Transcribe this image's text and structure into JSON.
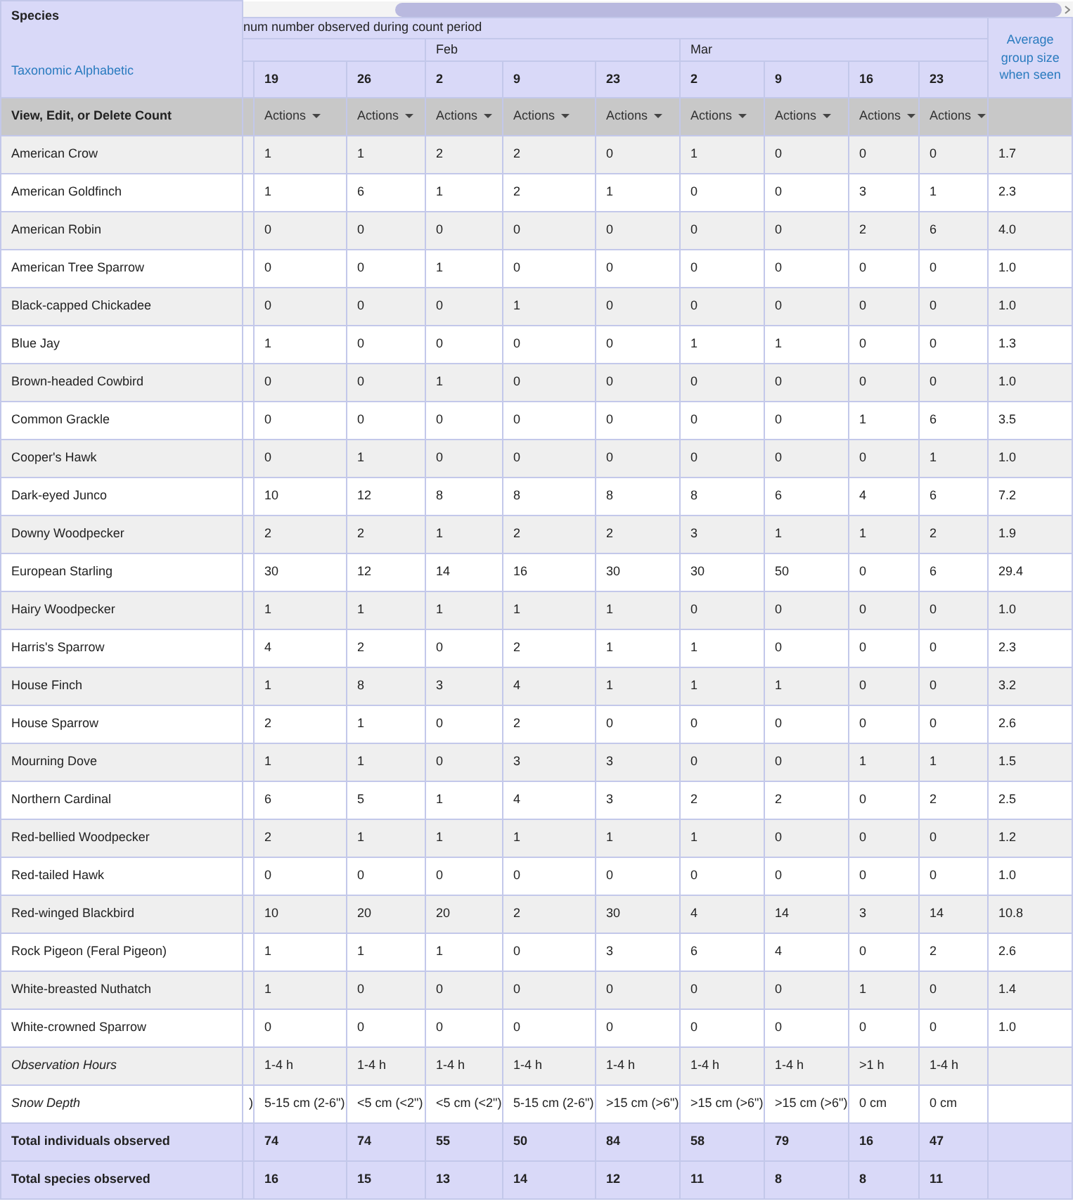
{
  "table": {
    "corner": {
      "title": "Species",
      "sort_link": "Taxonomic Alphabetic"
    },
    "group_header": "num number observed during count period",
    "date_groups": [
      {
        "dates": [
          "19",
          "26"
        ]
      },
      {
        "label": "Feb",
        "dates": [
          "2",
          "9",
          "23"
        ]
      },
      {
        "label": "Mar",
        "dates": [
          "2",
          "9",
          "16",
          "23"
        ]
      }
    ],
    "average_header": "Average group size when seen",
    "actions_row": {
      "label": "View, Edit, or Delete Count",
      "buttons": [
        "Actions",
        "Actions",
        "Actions",
        "Actions",
        "Actions",
        "Actions",
        "Actions",
        "Actions",
        "Actions"
      ]
    },
    "rows": [
      {
        "kind": "species",
        "name": "American Crow",
        "values": [
          "1",
          "1",
          "2",
          "2",
          "0",
          "1",
          "0",
          "0",
          "0"
        ],
        "average": "1.7"
      },
      {
        "kind": "species",
        "name": "American Goldfinch",
        "values": [
          "1",
          "6",
          "1",
          "2",
          "1",
          "0",
          "0",
          "3",
          "1"
        ],
        "average": "2.3"
      },
      {
        "kind": "species",
        "name": "American Robin",
        "values": [
          "0",
          "0",
          "0",
          "0",
          "0",
          "0",
          "0",
          "2",
          "6"
        ],
        "average": "4.0"
      },
      {
        "kind": "species",
        "name": "American Tree Sparrow",
        "values": [
          "0",
          "0",
          "1",
          "0",
          "0",
          "0",
          "0",
          "0",
          "0"
        ],
        "average": "1.0"
      },
      {
        "kind": "species",
        "name": "Black-capped Chickadee",
        "values": [
          "0",
          "0",
          "0",
          "1",
          "0",
          "0",
          "0",
          "0",
          "0"
        ],
        "average": "1.0"
      },
      {
        "kind": "species",
        "name": "Blue Jay",
        "values": [
          "1",
          "0",
          "0",
          "0",
          "0",
          "1",
          "1",
          "0",
          "0"
        ],
        "average": "1.3"
      },
      {
        "kind": "species",
        "name": "Brown-headed Cowbird",
        "values": [
          "0",
          "0",
          "1",
          "0",
          "0",
          "0",
          "0",
          "0",
          "0"
        ],
        "average": "1.0"
      },
      {
        "kind": "species",
        "name": "Common Grackle",
        "values": [
          "0",
          "0",
          "0",
          "0",
          "0",
          "0",
          "0",
          "1",
          "6"
        ],
        "average": "3.5"
      },
      {
        "kind": "species",
        "name": "Cooper's Hawk",
        "values": [
          "0",
          "1",
          "0",
          "0",
          "0",
          "0",
          "0",
          "0",
          "1"
        ],
        "average": "1.0"
      },
      {
        "kind": "species",
        "name": "Dark-eyed Junco",
        "values": [
          "10",
          "12",
          "8",
          "8",
          "8",
          "8",
          "6",
          "4",
          "6"
        ],
        "average": "7.2"
      },
      {
        "kind": "species",
        "name": "Downy Woodpecker",
        "values": [
          "2",
          "2",
          "1",
          "2",
          "2",
          "3",
          "1",
          "1",
          "2"
        ],
        "average": "1.9"
      },
      {
        "kind": "species",
        "name": "European Starling",
        "values": [
          "30",
          "12",
          "14",
          "16",
          "30",
          "30",
          "50",
          "0",
          "6"
        ],
        "average": "29.4"
      },
      {
        "kind": "species",
        "name": "Hairy Woodpecker",
        "values": [
          "1",
          "1",
          "1",
          "1",
          "1",
          "0",
          "0",
          "0",
          "0"
        ],
        "average": "1.0"
      },
      {
        "kind": "species",
        "name": "Harris's Sparrow",
        "values": [
          "4",
          "2",
          "0",
          "2",
          "1",
          "1",
          "0",
          "0",
          "0"
        ],
        "average": "2.3"
      },
      {
        "kind": "species",
        "name": "House Finch",
        "values": [
          "1",
          "8",
          "3",
          "4",
          "1",
          "1",
          "1",
          "0",
          "0"
        ],
        "average": "3.2"
      },
      {
        "kind": "species",
        "name": "House Sparrow",
        "values": [
          "2",
          "1",
          "0",
          "2",
          "0",
          "0",
          "0",
          "0",
          "0"
        ],
        "average": "2.6"
      },
      {
        "kind": "species",
        "name": "Mourning Dove",
        "values": [
          "1",
          "1",
          "0",
          "3",
          "3",
          "0",
          "0",
          "1",
          "1"
        ],
        "average": "1.5"
      },
      {
        "kind": "species",
        "name": "Northern Cardinal",
        "values": [
          "6",
          "5",
          "1",
          "4",
          "3",
          "2",
          "2",
          "0",
          "2"
        ],
        "average": "2.5"
      },
      {
        "kind": "species",
        "name": "Red-bellied Woodpecker",
        "values": [
          "2",
          "1",
          "1",
          "1",
          "1",
          "1",
          "0",
          "0",
          "0"
        ],
        "average": "1.2"
      },
      {
        "kind": "species",
        "name": "Red-tailed Hawk",
        "values": [
          "0",
          "0",
          "0",
          "0",
          "0",
          "0",
          "0",
          "0",
          "0"
        ],
        "average": "1.0"
      },
      {
        "kind": "species",
        "name": "Red-winged Blackbird",
        "values": [
          "10",
          "20",
          "20",
          "2",
          "30",
          "4",
          "14",
          "3",
          "14"
        ],
        "average": "10.8"
      },
      {
        "kind": "species",
        "name": "Rock Pigeon (Feral Pigeon)",
        "values": [
          "1",
          "1",
          "1",
          "0",
          "3",
          "6",
          "4",
          "0",
          "2"
        ],
        "average": "2.6"
      },
      {
        "kind": "species",
        "name": "White-breasted Nuthatch",
        "values": [
          "1",
          "0",
          "0",
          "0",
          "0",
          "0",
          "0",
          "1",
          "0"
        ],
        "average": "1.4"
      },
      {
        "kind": "species",
        "name": "White-crowned Sparrow",
        "values": [
          "0",
          "0",
          "0",
          "0",
          "0",
          "0",
          "0",
          "0",
          "0"
        ],
        "average": "1.0"
      },
      {
        "kind": "condition",
        "name": "Observation Hours",
        "values": [
          "1-4 h",
          "1-4 h",
          "1-4 h",
          "1-4 h",
          "1-4 h",
          "1-4 h",
          "1-4 h",
          ">1 h",
          "1-4 h"
        ]
      },
      {
        "kind": "condition",
        "name": "Snow Depth",
        "cut_value": ")",
        "values": [
          "5-15 cm (2-6\")",
          "<5 cm (<2\")",
          "<5 cm (<2\")",
          "5-15 cm (2-6\")",
          ">15 cm (>6\")",
          ">15 cm (>6\")",
          ">15 cm (>6\")",
          "0 cm",
          "0 cm"
        ]
      },
      {
        "kind": "total",
        "name": "Total individuals observed",
        "values": [
          "74",
          "74",
          "55",
          "50",
          "84",
          "58",
          "79",
          "16",
          "47"
        ]
      },
      {
        "kind": "total",
        "name": "Total species observed",
        "values": [
          "16",
          "15",
          "13",
          "14",
          "12",
          "11",
          "8",
          "8",
          "11"
        ]
      }
    ]
  }
}
